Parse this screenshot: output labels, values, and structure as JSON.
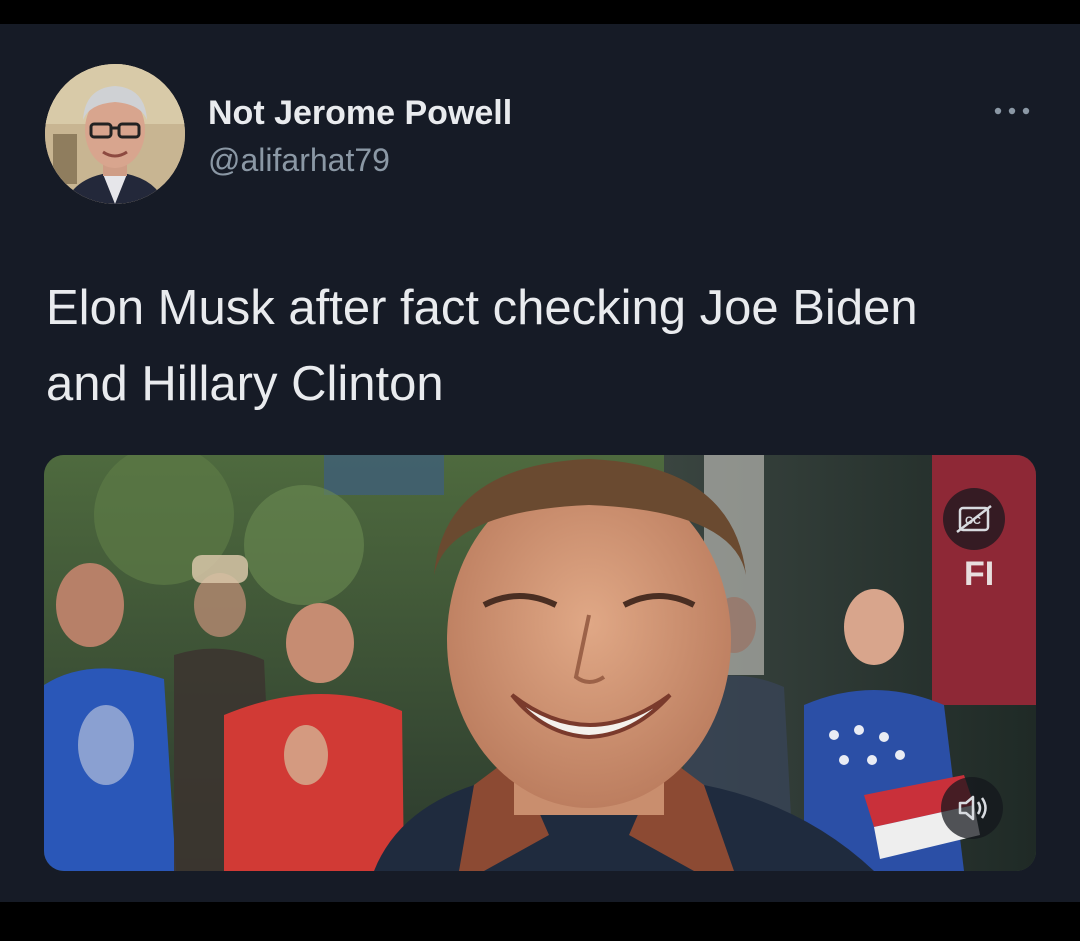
{
  "tweet": {
    "author": {
      "display_name": "Not Jerome Powell",
      "handle": "@alifarhat79",
      "avatar_icon": "user-avatar"
    },
    "text": "Elon Musk after fact checking Joe Biden and Hillary Clinton",
    "more_icon": "more-horizontal-icon",
    "media": {
      "type": "video",
      "captions_icon": "captions-icon",
      "volume_icon": "volume-icon"
    }
  },
  "colors": {
    "background": "#161b26",
    "outer": "#000000",
    "primary_text": "#e9ebee",
    "secondary_text": "#8b98a5"
  }
}
